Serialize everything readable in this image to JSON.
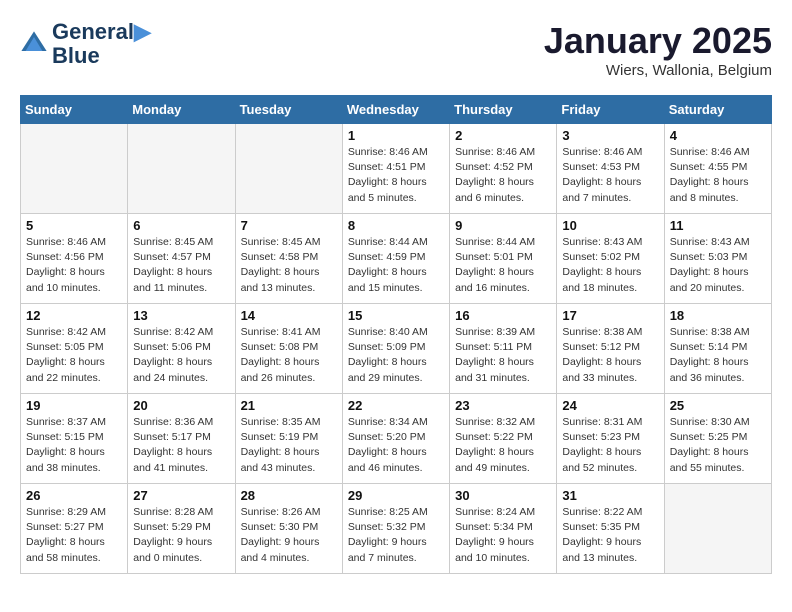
{
  "logo": {
    "line1": "General",
    "line2": "Blue"
  },
  "title": "January 2025",
  "location": "Wiers, Wallonia, Belgium",
  "days_of_week": [
    "Sunday",
    "Monday",
    "Tuesday",
    "Wednesday",
    "Thursday",
    "Friday",
    "Saturday"
  ],
  "weeks": [
    [
      {
        "num": "",
        "info": ""
      },
      {
        "num": "",
        "info": ""
      },
      {
        "num": "",
        "info": ""
      },
      {
        "num": "1",
        "info": "Sunrise: 8:46 AM\nSunset: 4:51 PM\nDaylight: 8 hours and 5 minutes."
      },
      {
        "num": "2",
        "info": "Sunrise: 8:46 AM\nSunset: 4:52 PM\nDaylight: 8 hours and 6 minutes."
      },
      {
        "num": "3",
        "info": "Sunrise: 8:46 AM\nSunset: 4:53 PM\nDaylight: 8 hours and 7 minutes."
      },
      {
        "num": "4",
        "info": "Sunrise: 8:46 AM\nSunset: 4:55 PM\nDaylight: 8 hours and 8 minutes."
      }
    ],
    [
      {
        "num": "5",
        "info": "Sunrise: 8:46 AM\nSunset: 4:56 PM\nDaylight: 8 hours and 10 minutes."
      },
      {
        "num": "6",
        "info": "Sunrise: 8:45 AM\nSunset: 4:57 PM\nDaylight: 8 hours and 11 minutes."
      },
      {
        "num": "7",
        "info": "Sunrise: 8:45 AM\nSunset: 4:58 PM\nDaylight: 8 hours and 13 minutes."
      },
      {
        "num": "8",
        "info": "Sunrise: 8:44 AM\nSunset: 4:59 PM\nDaylight: 8 hours and 15 minutes."
      },
      {
        "num": "9",
        "info": "Sunrise: 8:44 AM\nSunset: 5:01 PM\nDaylight: 8 hours and 16 minutes."
      },
      {
        "num": "10",
        "info": "Sunrise: 8:43 AM\nSunset: 5:02 PM\nDaylight: 8 hours and 18 minutes."
      },
      {
        "num": "11",
        "info": "Sunrise: 8:43 AM\nSunset: 5:03 PM\nDaylight: 8 hours and 20 minutes."
      }
    ],
    [
      {
        "num": "12",
        "info": "Sunrise: 8:42 AM\nSunset: 5:05 PM\nDaylight: 8 hours and 22 minutes."
      },
      {
        "num": "13",
        "info": "Sunrise: 8:42 AM\nSunset: 5:06 PM\nDaylight: 8 hours and 24 minutes."
      },
      {
        "num": "14",
        "info": "Sunrise: 8:41 AM\nSunset: 5:08 PM\nDaylight: 8 hours and 26 minutes."
      },
      {
        "num": "15",
        "info": "Sunrise: 8:40 AM\nSunset: 5:09 PM\nDaylight: 8 hours and 29 minutes."
      },
      {
        "num": "16",
        "info": "Sunrise: 8:39 AM\nSunset: 5:11 PM\nDaylight: 8 hours and 31 minutes."
      },
      {
        "num": "17",
        "info": "Sunrise: 8:38 AM\nSunset: 5:12 PM\nDaylight: 8 hours and 33 minutes."
      },
      {
        "num": "18",
        "info": "Sunrise: 8:38 AM\nSunset: 5:14 PM\nDaylight: 8 hours and 36 minutes."
      }
    ],
    [
      {
        "num": "19",
        "info": "Sunrise: 8:37 AM\nSunset: 5:15 PM\nDaylight: 8 hours and 38 minutes."
      },
      {
        "num": "20",
        "info": "Sunrise: 8:36 AM\nSunset: 5:17 PM\nDaylight: 8 hours and 41 minutes."
      },
      {
        "num": "21",
        "info": "Sunrise: 8:35 AM\nSunset: 5:19 PM\nDaylight: 8 hours and 43 minutes."
      },
      {
        "num": "22",
        "info": "Sunrise: 8:34 AM\nSunset: 5:20 PM\nDaylight: 8 hours and 46 minutes."
      },
      {
        "num": "23",
        "info": "Sunrise: 8:32 AM\nSunset: 5:22 PM\nDaylight: 8 hours and 49 minutes."
      },
      {
        "num": "24",
        "info": "Sunrise: 8:31 AM\nSunset: 5:23 PM\nDaylight: 8 hours and 52 minutes."
      },
      {
        "num": "25",
        "info": "Sunrise: 8:30 AM\nSunset: 5:25 PM\nDaylight: 8 hours and 55 minutes."
      }
    ],
    [
      {
        "num": "26",
        "info": "Sunrise: 8:29 AM\nSunset: 5:27 PM\nDaylight: 8 hours and 58 minutes."
      },
      {
        "num": "27",
        "info": "Sunrise: 8:28 AM\nSunset: 5:29 PM\nDaylight: 9 hours and 0 minutes."
      },
      {
        "num": "28",
        "info": "Sunrise: 8:26 AM\nSunset: 5:30 PM\nDaylight: 9 hours and 4 minutes."
      },
      {
        "num": "29",
        "info": "Sunrise: 8:25 AM\nSunset: 5:32 PM\nDaylight: 9 hours and 7 minutes."
      },
      {
        "num": "30",
        "info": "Sunrise: 8:24 AM\nSunset: 5:34 PM\nDaylight: 9 hours and 10 minutes."
      },
      {
        "num": "31",
        "info": "Sunrise: 8:22 AM\nSunset: 5:35 PM\nDaylight: 9 hours and 13 minutes."
      },
      {
        "num": "",
        "info": ""
      }
    ]
  ]
}
